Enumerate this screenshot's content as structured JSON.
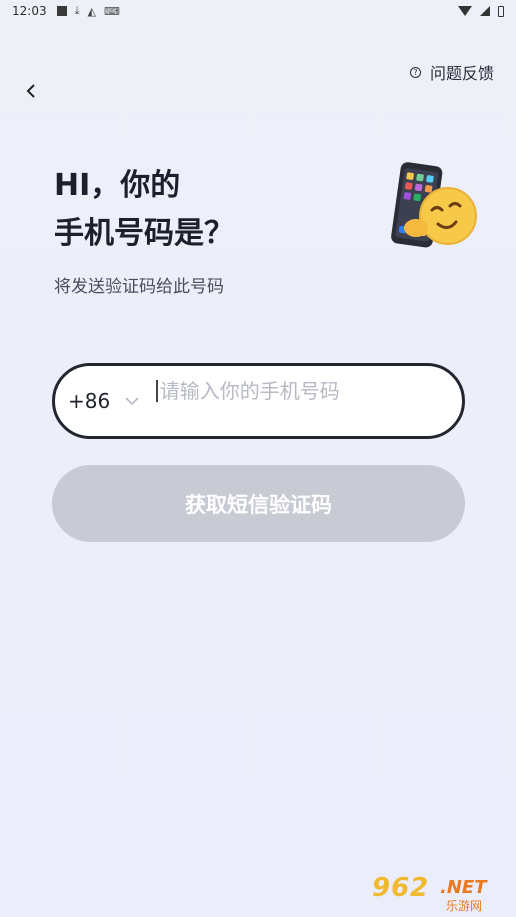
{
  "status_bar": {
    "time": "12:03",
    "icons": [
      "square-icon",
      "download-icon",
      "a-icon",
      "keyboard-icon",
      "wifi-icon",
      "signal-icon",
      "battery-icon"
    ]
  },
  "header": {
    "back_icon": "chevron-left-icon",
    "feedback_label": "问题反馈",
    "feedback_icon": "question-circle-icon"
  },
  "main": {
    "title_line1": "HI，你的",
    "title_line2": "手机号码是？",
    "subtitle": "将发送验证码给此号码"
  },
  "phone_input": {
    "country_code": "+86",
    "placeholder": "请输入你的手机号码",
    "value": ""
  },
  "sms_button": {
    "label": "获取短信验证码"
  },
  "watermark": {
    "number": "962",
    "suffix": ".NET",
    "caption": "乐游网"
  },
  "colors": {
    "background": "#eceefa",
    "input_border": "#23262f",
    "button_disabled": "#c8cad4",
    "text_primary": "#1c202b",
    "placeholder": "#b7bac4"
  }
}
